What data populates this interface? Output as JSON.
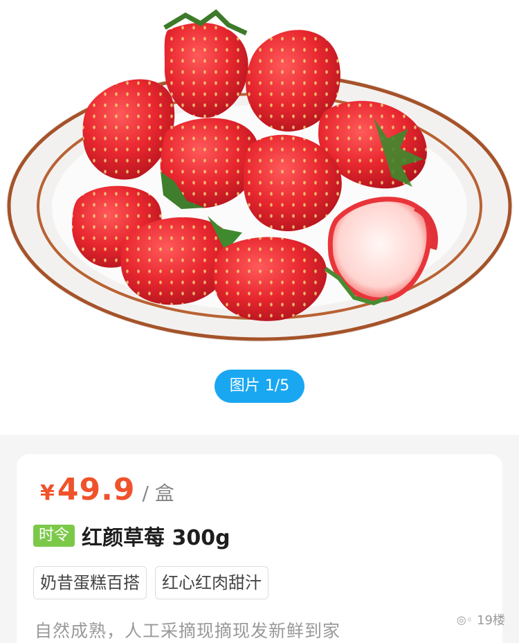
{
  "gallery": {
    "pager_label": "图片 1/5",
    "image_alt": "strawberries in a plate"
  },
  "product": {
    "currency": "¥",
    "price": "49.9",
    "unit": "/ 盒",
    "season_tag": "时令",
    "title": "红颜草莓 300g",
    "tags": [
      "奶昔蛋糕百搭",
      "红心红肉甜汁"
    ],
    "description": "自然成熟，人工采摘现摘现发新鲜到家"
  },
  "watermark": {
    "icon": "wechat-icon",
    "text": "19楼"
  },
  "colors": {
    "accent_blue": "#1aa7f2",
    "price_red": "#f0522b",
    "season_green": "#7cc94a"
  }
}
